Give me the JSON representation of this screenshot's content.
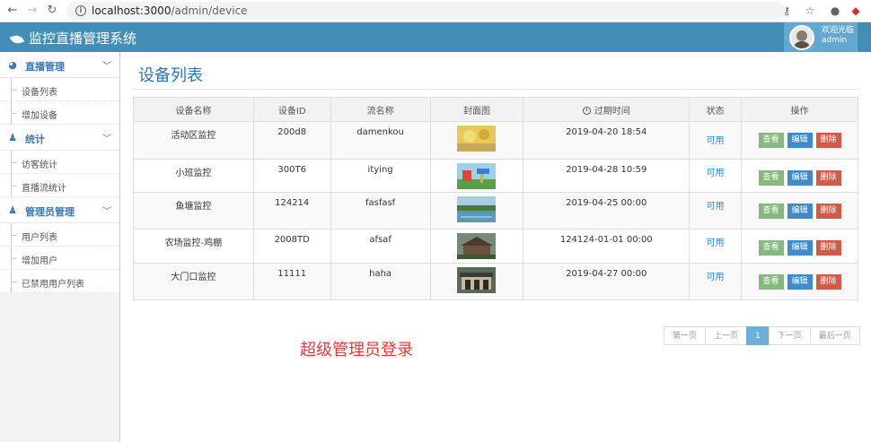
{
  "browser": {
    "url_host": "localhost:3000",
    "url_path": "/admin/device"
  },
  "header": {
    "brand": "监控直播管理系统",
    "welcome": "欢迎光临",
    "username": "admin"
  },
  "sidebar": {
    "groups": [
      {
        "label": "直播管理",
        "icon": "dashboard-icon",
        "items": [
          "设备列表",
          "增加设备"
        ]
      },
      {
        "label": "统计",
        "icon": "user-stat-icon",
        "items": [
          "访客统计",
          "直播流统计"
        ]
      },
      {
        "label": "管理员管理",
        "icon": "admin-user-icon",
        "items": [
          "用户列表",
          "增加用户",
          "已禁用用户列表"
        ]
      }
    ]
  },
  "main": {
    "title": "设备列表",
    "table": {
      "headers": [
        "设备名称",
        "设备ID",
        "流名称",
        "封面图",
        "过期时间",
        "状态",
        "操作"
      ],
      "rows": [
        {
          "name": "活动区监控",
          "id": "200d8",
          "stream": "damenkou",
          "expire": "2019-04-20 18:54",
          "status": "可用"
        },
        {
          "name": "小班监控",
          "id": "300T6",
          "stream": "itying",
          "expire": "2019-04-28 10:59",
          "status": "可用"
        },
        {
          "name": "鱼塘监控",
          "id": "124214",
          "stream": "fasfasf",
          "expire": "2019-04-25 00:00",
          "status": "可用"
        },
        {
          "name": "农场监控-鸡棚",
          "id": "2008TD",
          "stream": "afsaf",
          "expire": "124124-01-01 00:00",
          "status": "可用"
        },
        {
          "name": "大门口监控",
          "id": "11111",
          "stream": "haha",
          "expire": "2019-04-27 00:00",
          "status": "可用"
        }
      ],
      "actions": {
        "view": "查看",
        "edit": "编辑",
        "delete": "删除"
      }
    },
    "pager": {
      "first": "第一页",
      "prev": "上一页",
      "current": "1",
      "next": "下一页",
      "last": "最后一页"
    },
    "notice": "超级管理员登录"
  },
  "colors": {
    "header": "#438eb9",
    "accent": "#2679b5",
    "notice": "#e63a3a"
  }
}
